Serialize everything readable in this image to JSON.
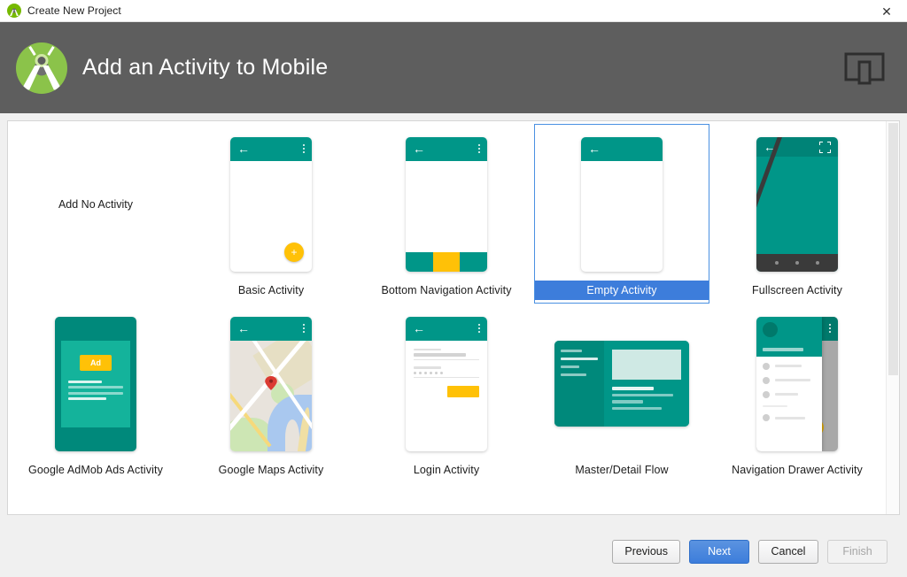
{
  "window": {
    "title": "Create New Project",
    "app_icon": "android-studio-icon",
    "close_label": "✕"
  },
  "header": {
    "title": "Add an Activity to Mobile",
    "logo": "android-studio-logo",
    "device_icon": "tablet-device-icon"
  },
  "colors": {
    "header_background": "#5e5e5e",
    "selection_blue": "#3d7ddb",
    "selection_border": "#4a90e2",
    "material_teal": "#009688",
    "material_teal_dark": "#00796b",
    "material_amber": "#FFC107",
    "panel_background": "#ffffff",
    "dialog_background": "#f0f0f0"
  },
  "gallery": {
    "selected_index": 3,
    "items": [
      {
        "label": "Add No Activity",
        "thumb": "none",
        "selected": false
      },
      {
        "label": "Basic Activity",
        "thumb": "basic",
        "selected": false
      },
      {
        "label": "Bottom Navigation Activity",
        "thumb": "bottom-nav",
        "selected": false
      },
      {
        "label": "Empty Activity",
        "thumb": "empty",
        "selected": true
      },
      {
        "label": "Fullscreen Activity",
        "thumb": "fullscreen",
        "selected": false
      },
      {
        "label": "Google AdMob Ads Activity",
        "thumb": "admob",
        "selected": false
      },
      {
        "label": "Google Maps Activity",
        "thumb": "maps",
        "selected": false
      },
      {
        "label": "Login Activity",
        "thumb": "login",
        "selected": false
      },
      {
        "label": "Master/Detail Flow",
        "thumb": "master-detail",
        "selected": false
      },
      {
        "label": "Navigation Drawer Activity",
        "thumb": "nav-drawer",
        "selected": false
      }
    ],
    "admob_badge": "Ad"
  },
  "footer": {
    "previous": "Previous",
    "next": "Next",
    "cancel": "Cancel",
    "finish": "Finish"
  }
}
